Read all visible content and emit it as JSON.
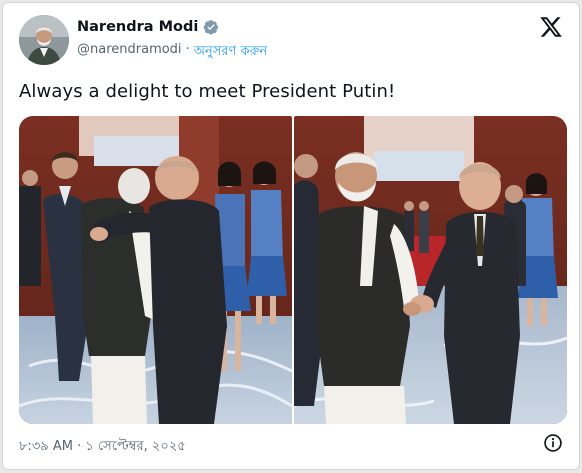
{
  "header": {
    "display_name": "Narendra Modi",
    "handle": "@narendramodi",
    "separator": "·",
    "follow_label": "অনুসরণ করুন",
    "verified_icon": "verified-badge-icon",
    "logo_icon": "x-logo-icon"
  },
  "tweet": {
    "text": "Always a delight to meet President Putin!"
  },
  "footer": {
    "timestamp": "৮:৩৯ AM · ১ সেপ্টেম্বর, ২০২৫",
    "info_icon": "info-icon"
  },
  "colors": {
    "accent": "#1d9bf0",
    "secondary_text": "#536471",
    "primary_text": "#0f1419"
  }
}
